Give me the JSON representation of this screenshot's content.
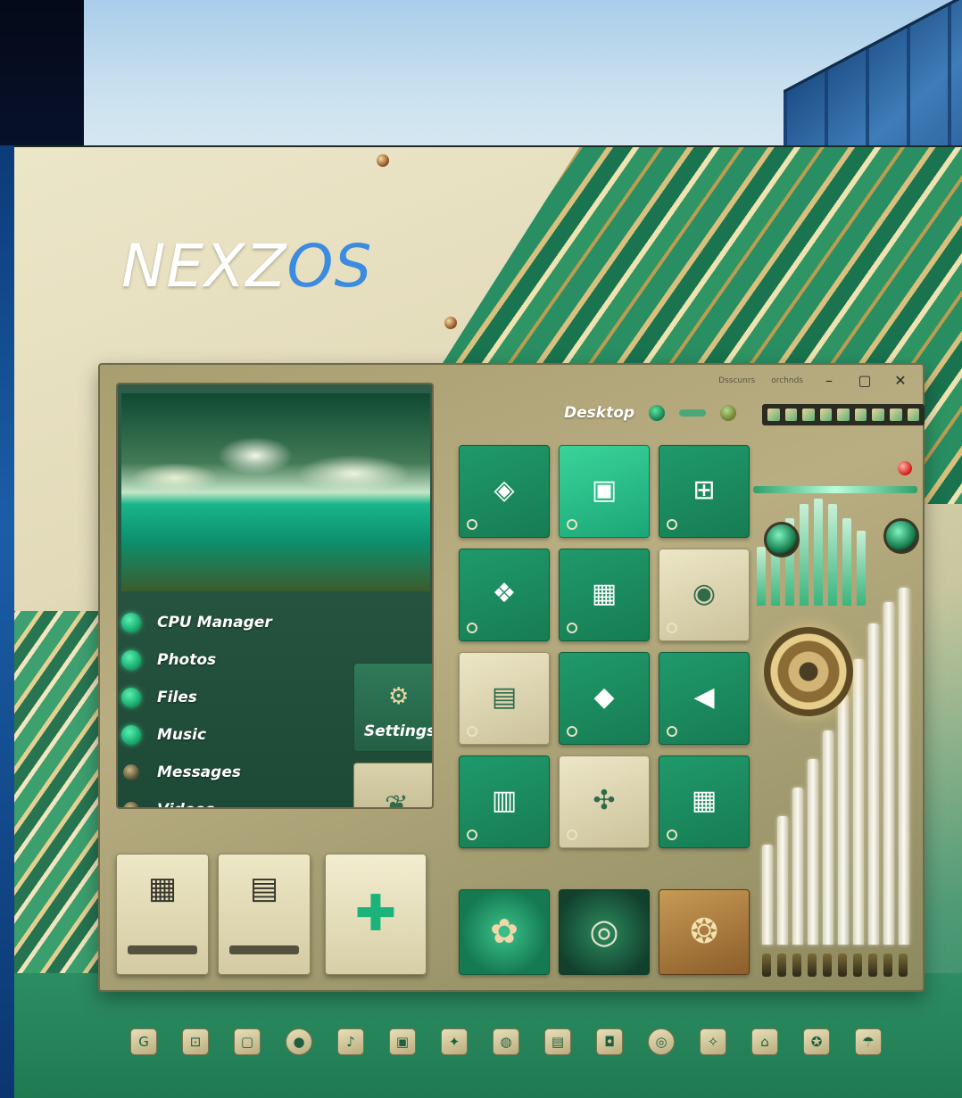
{
  "brand": {
    "part1": "NEXZ",
    "part2": "OS"
  },
  "window": {
    "header_small_text": [
      "Dsscunrs",
      "orchnds"
    ],
    "controls": {
      "minimize": "–",
      "maximize": "▢",
      "close": "✕"
    }
  },
  "apps": [
    {
      "label": "CPU Manager",
      "icon": "cpu-icon"
    },
    {
      "label": "Photos",
      "icon": "photos-icon"
    },
    {
      "label": "Files",
      "icon": "files-icon"
    },
    {
      "label": "Music",
      "icon": "music-icon"
    },
    {
      "label": "Messages",
      "icon": "messages-icon"
    },
    {
      "label": "Videos",
      "icon": "videos-icon"
    }
  ],
  "settings_tile": {
    "label": "Settings",
    "icon": "⚙"
  },
  "desktop": {
    "label": "Desktop"
  },
  "grid_tiles": [
    {
      "style": "green",
      "icon": "◈"
    },
    {
      "style": "bright",
      "icon": "▣"
    },
    {
      "style": "green",
      "icon": "⊞"
    },
    {
      "style": "green",
      "icon": "❖"
    },
    {
      "style": "green",
      "icon": "▦"
    },
    {
      "style": "cream",
      "icon": "◉"
    },
    {
      "style": "cream",
      "icon": "▤"
    },
    {
      "style": "green",
      "icon": "◆"
    },
    {
      "style": "green",
      "icon": "◀"
    },
    {
      "style": "green",
      "icon": "▥"
    },
    {
      "style": "cream",
      "icon": "✣"
    },
    {
      "style": "green",
      "icon": "▦"
    }
  ],
  "dock_tiles": [
    {
      "icon": "▦"
    },
    {
      "icon": "▤"
    },
    {
      "icon": "✚"
    }
  ],
  "bottom_tiles": [
    {
      "style": "flower",
      "icon": "✿"
    },
    {
      "style": "chip",
      "icon": "◎"
    },
    {
      "style": "gold",
      "icon": "❂"
    }
  ],
  "eq_levels": [
    0.28,
    0.36,
    0.44,
    0.52,
    0.6,
    0.7,
    0.8,
    0.9,
    0.96,
    1.0
  ],
  "eq_small_levels": [
    0.55,
    0.7,
    0.82,
    0.95,
    1.0,
    0.95,
    0.82,
    0.7
  ],
  "dock": [
    "G",
    "⊡",
    "▢",
    "●",
    "♪",
    "▣",
    "✦",
    "◍",
    "▤",
    "◘",
    "◎",
    "✧",
    "⌂",
    "✪",
    "☂"
  ],
  "colors": {
    "accent_green": "#1f9a6a",
    "brand_blue": "#3b8be0",
    "cream": "#ede6c6",
    "gold": "#c79a55"
  }
}
